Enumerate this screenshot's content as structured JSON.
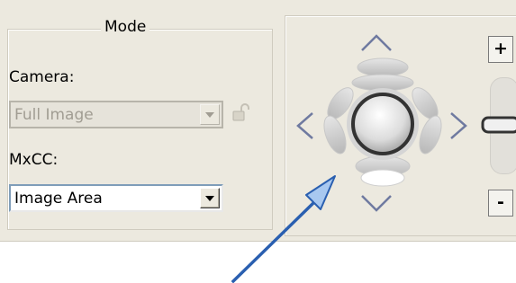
{
  "mode_group": {
    "title": "Mode",
    "camera_label": "Camera:",
    "camera_select": {
      "value": "Full Image",
      "enabled": false
    },
    "mxcc_label": "MxCC:",
    "mxcc_select": {
      "value": "Image Area",
      "enabled": true
    }
  },
  "pad": {
    "zoom_in_label": "+",
    "zoom_out_label": "-"
  },
  "colors": {
    "panel_bg": "#ece9df",
    "annotation_arrow": "#a8c8f0",
    "annotation_arrow_stroke": "#2a5fb0"
  }
}
